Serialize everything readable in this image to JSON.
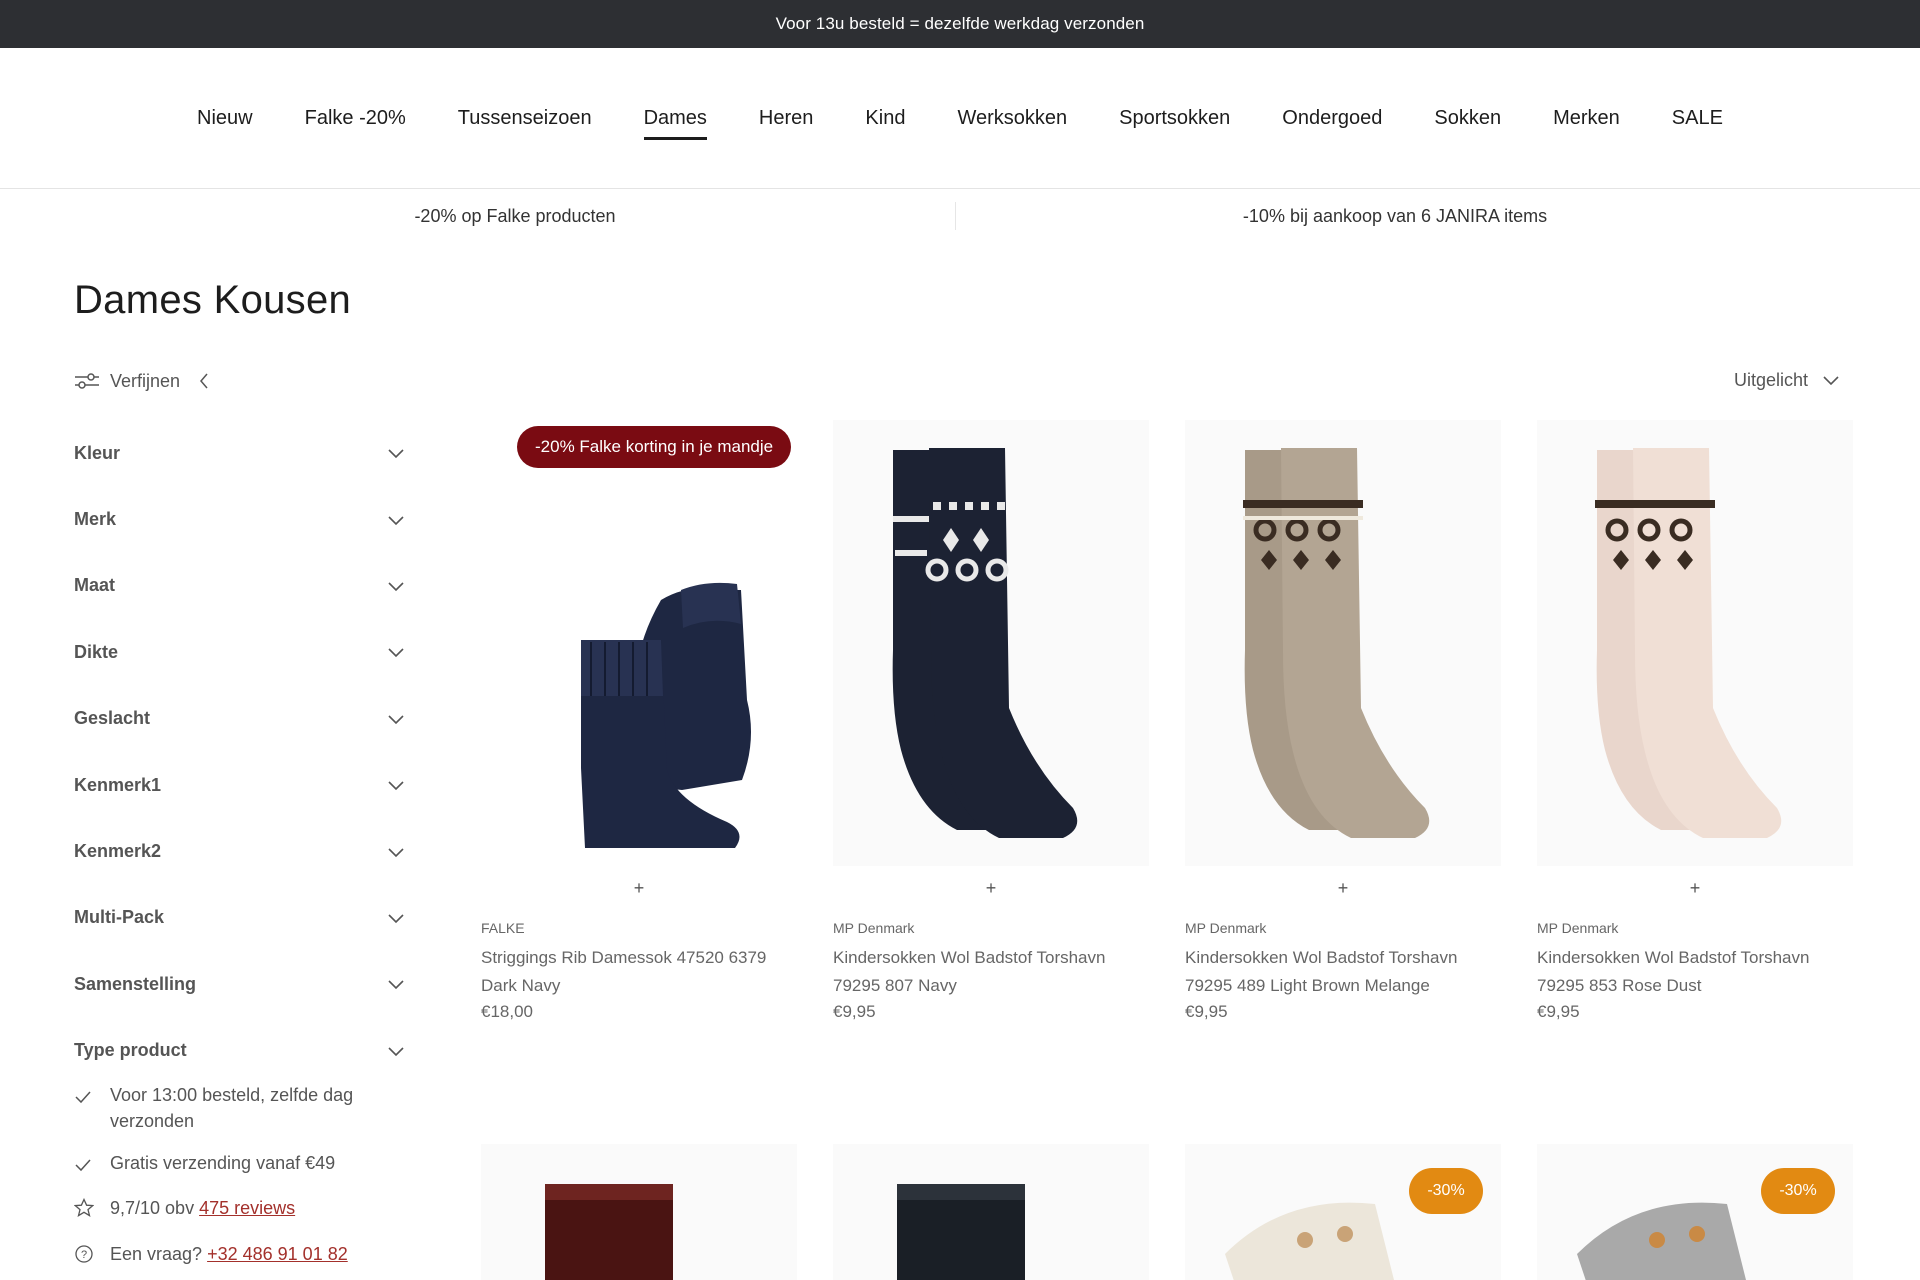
{
  "announcement": "Voor 13u besteld = dezelfde werkdag verzonden",
  "nav": {
    "items": [
      "Nieuw",
      "Falke -20%",
      "Tussenseizoen",
      "Dames",
      "Heren",
      "Kind",
      "Werksokken",
      "Sportsokken",
      "Ondergoed",
      "Sokken",
      "Merken",
      "SALE"
    ],
    "active": "Dames"
  },
  "promos": [
    "-20% op Falke producten",
    "-10% bij aankoop van 6 JANIRA items"
  ],
  "page_title": "Dames Kousen",
  "refine_label": "Verfijnen",
  "sort_label": "Uitgelicht",
  "filters": [
    "Kleur",
    "Merk",
    "Maat",
    "Dikte",
    "Geslacht",
    "Kenmerk1",
    "Kenmerk2",
    "Multi-Pack",
    "Samenstelling",
    "Type product"
  ],
  "usps": {
    "same_day": "Voor 13:00 besteld, zelfde dag verzonden",
    "free_shipping": "Gratis verzending vanaf €49",
    "rating_prefix": "9,7/10 obv",
    "rating_link": "475 reviews",
    "question_prefix": "Een vraag?",
    "question_phone": "+32 486 91 01 82"
  },
  "products": [
    {
      "brand": "FALKE",
      "name": "Striggings Rib Damessok 47520 6379 Dark Navy",
      "price": "€18,00",
      "badge": "-20% Falke korting in je mandje",
      "plus": "+"
    },
    {
      "brand": "MP Denmark",
      "name": "Kindersokken Wol Badstof Torshavn 79295 807 Navy",
      "price": "€9,95",
      "plus": "+"
    },
    {
      "brand": "MP Denmark",
      "name": "Kindersokken Wol Badstof Torshavn 79295 489 Light Brown Melange",
      "price": "€9,95",
      "plus": "+"
    },
    {
      "brand": "MP Denmark",
      "name": "Kindersokken Wol Badstof Torshavn 79295 853 Rose Dust",
      "price": "€9,95",
      "plus": "+"
    }
  ],
  "row2_badges": [
    "-30%",
    "-30%"
  ],
  "colors": {
    "topbar": "#2d2f33",
    "badge_red": "#7a0b12",
    "badge_orange": "#e28a12",
    "link": "#a3302b"
  }
}
